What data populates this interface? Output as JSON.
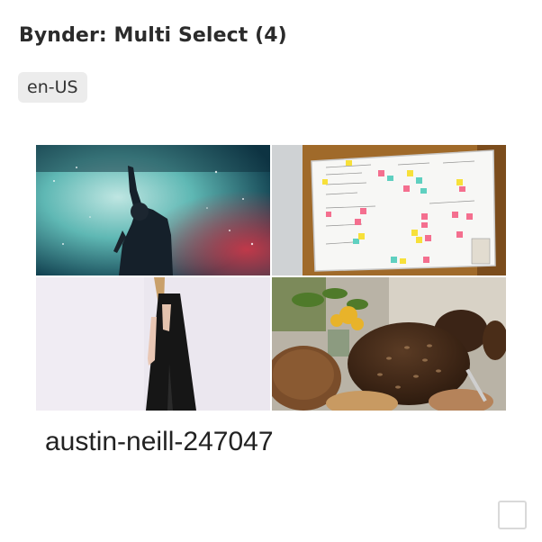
{
  "header": {
    "title": "Bynder: Multi Select (4)"
  },
  "locale": {
    "label": "en-US"
  },
  "gallery": {
    "images": [
      {
        "name": "concert-performer-photo"
      },
      {
        "name": "whiteboard-sticky-notes-photo"
      },
      {
        "name": "woman-black-dress-photo"
      },
      {
        "name": "bread-loaves-photo"
      }
    ],
    "caption": "austin-neill-247047"
  },
  "colors": {
    "badge_bg": "#ececec",
    "checkbox_border": "#d9d9d9"
  }
}
